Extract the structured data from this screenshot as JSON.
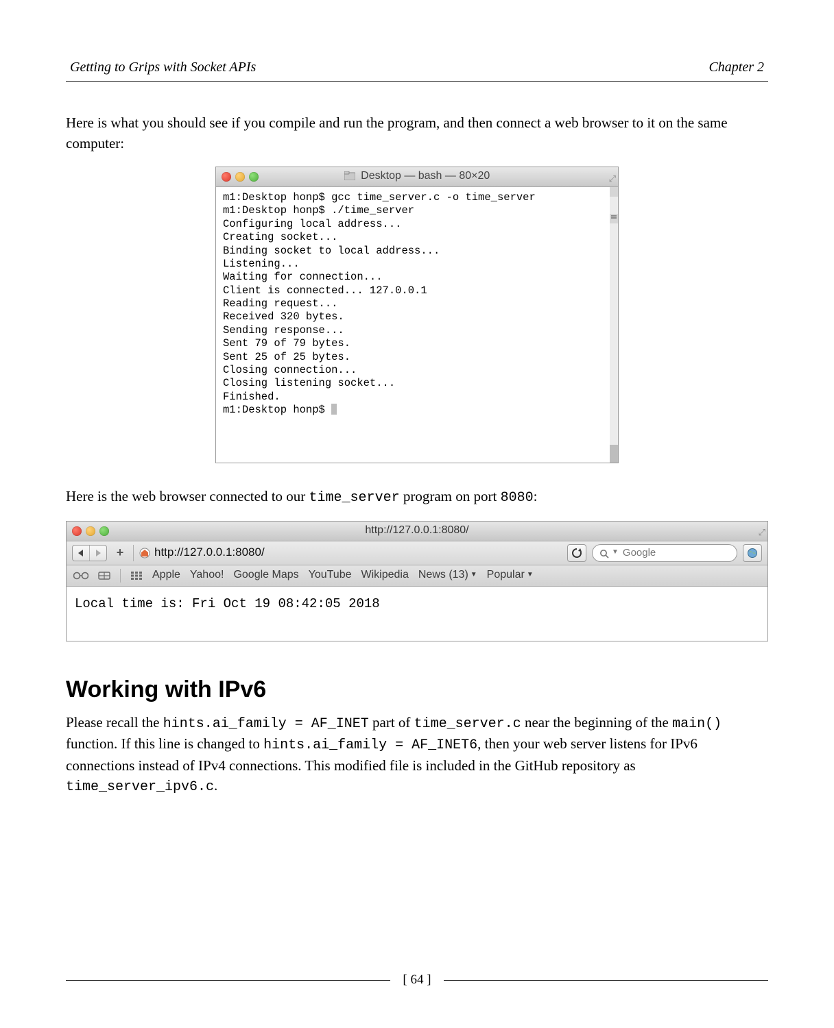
{
  "header": {
    "left": "Getting to Grips with Socket APIs",
    "right": "Chapter 2"
  },
  "intro1": "Here is what you should see if you compile and run the program, and then connect a web browser to it on the same computer:",
  "terminal": {
    "title": "Desktop — bash — 80×20",
    "lines": "m1:Desktop honp$ gcc time_server.c -o time_server\nm1:Desktop honp$ ./time_server\nConfiguring local address...\nCreating socket...\nBinding socket to local address...\nListening...\nWaiting for connection...\nClient is connected... 127.0.0.1\nReading request...\nReceived 320 bytes.\nSending response...\nSent 79 of 79 bytes.\nSent 25 of 25 bytes.\nClosing connection...\nClosing listening socket...\nFinished.\nm1:Desktop honp$ "
  },
  "intro2_parts": {
    "pre": "Here is the web browser connected to our ",
    "code1": "time_server",
    "mid": " program on port ",
    "code2": "8080",
    "post": ":"
  },
  "browser": {
    "title": "http://127.0.0.1:8080/",
    "url": "http://127.0.0.1:8080/",
    "search_placeholder": "Google",
    "bookmarks": [
      "Apple",
      "Yahoo!",
      "Google Maps",
      "YouTube",
      "Wikipedia",
      "News (13)",
      "Popular"
    ],
    "page_text": "Local time is: Fri Oct 19 08:42:05 2018"
  },
  "section": {
    "heading": "Working with IPv6",
    "p_parts": {
      "t1": "Please recall the ",
      "c1": "hints.ai_family = AF_INET",
      "t2": " part of ",
      "c2": "time_server.c",
      "t3": " near the beginning of the ",
      "c3": "main()",
      "t4": " function. If this line is changed to ",
      "c4": "hints.ai_family = AF_INET6",
      "t5": ", then your web server listens for IPv6 connections instead of IPv4 connections. This modified file is included in the GitHub repository as ",
      "c5": "time_server_ipv6.c",
      "t6": "."
    }
  },
  "page_number": "[ 64 ]"
}
